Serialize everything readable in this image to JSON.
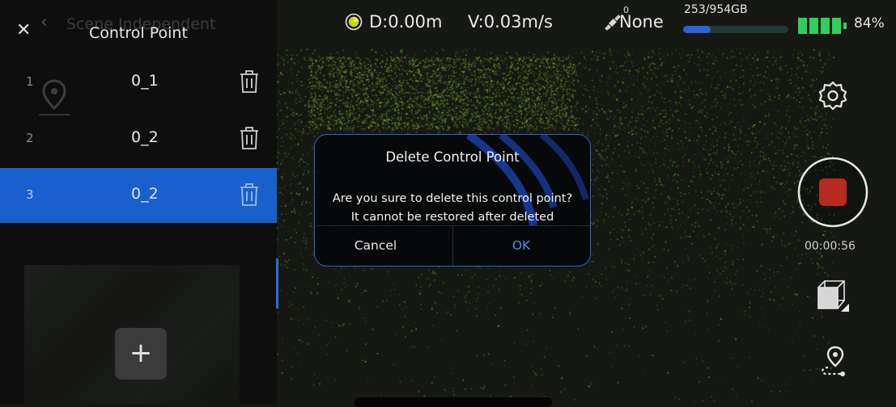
{
  "status": {
    "distance": "D:0.00m",
    "velocity": "V:0.03m/s",
    "satellite_count": "0",
    "rtk_status": "None",
    "storage_text": "253/954GB",
    "storage_fraction": 0.265,
    "battery_text": "84%",
    "battery_fraction": 0.84
  },
  "panel": {
    "ghost_title": "Scene Independent",
    "title": "Control Point",
    "rows": [
      {
        "index": "1",
        "name": "0_1",
        "selected": false
      },
      {
        "index": "2",
        "name": "0_2",
        "selected": false
      },
      {
        "index": "3",
        "name": "0_2",
        "selected": true
      }
    ],
    "add_label": "+"
  },
  "dialog": {
    "title": "Delete Control Point",
    "line1": "Are you sure to delete this control point?",
    "line2": "It cannot be restored after deleted",
    "cancel": "Cancel",
    "ok": "OK"
  },
  "toolbar": {
    "record_time": "00:00:56"
  },
  "icons": {
    "close": "close-icon",
    "back": "back-chevron-icon",
    "delete": "trash-icon",
    "settings": "gear-icon",
    "record": "record-stop-icon",
    "view": "cube-icon",
    "route": "route-pin-icon",
    "satellite": "satellite-icon",
    "battery": "battery-icon"
  },
  "colors": {
    "accent": "#1a60cc",
    "ok": "#4a8ff0",
    "record": "#b72a1f",
    "battery": "#2fd05a",
    "cloud": "#8bbf2a"
  }
}
